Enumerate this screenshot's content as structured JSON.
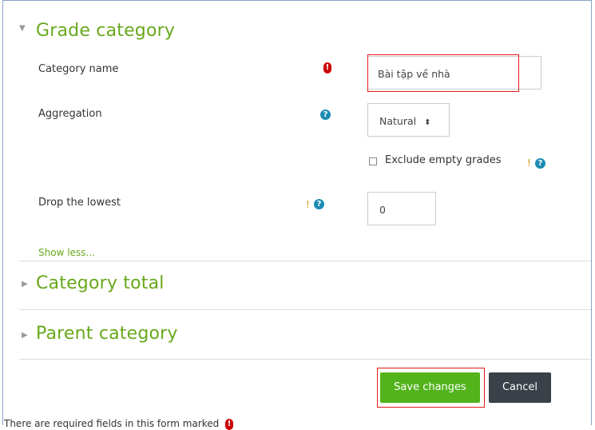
{
  "sections": {
    "grade_category": {
      "caret": "▼",
      "title": "Grade category",
      "category_name_label": "Category name",
      "category_name_value": "Bài tập về nhà",
      "aggregation_label": "Aggregation",
      "aggregation_value": "Natural",
      "aggregation_arrow": "⬍",
      "exclude_empty_label": "Exclude empty grades",
      "drop_lowest_label": "Drop the lowest",
      "drop_lowest_value": "0",
      "show_less": "Show less..."
    },
    "category_total": {
      "caret": "▶",
      "title": "Category total"
    },
    "parent_category": {
      "caret": "▶",
      "title": "Parent category"
    }
  },
  "icons": {
    "required_glyph": "!",
    "help_glyph": "?",
    "advanced_glyph": "!"
  },
  "buttons": {
    "save": "Save changes",
    "cancel": "Cancel"
  },
  "footer": {
    "required_note": "There are required fields in this form marked"
  },
  "colors": {
    "accent_green": "#67a81b",
    "primary_button": "#52b31b",
    "secondary_button": "#3a4148",
    "required_red": "#cc0000",
    "help_blue": "#1b8bb4",
    "highlight_red": "#e31b1b"
  }
}
